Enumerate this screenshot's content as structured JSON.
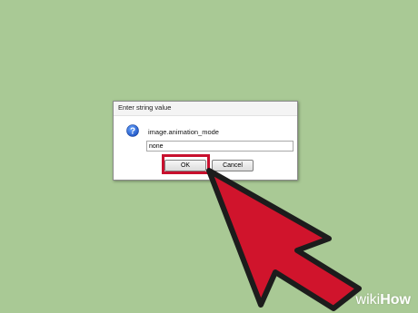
{
  "dialog": {
    "title": "Enter string value",
    "icon": "question-icon",
    "prompt_label": "image.animation_mode",
    "input_value": "none",
    "ok_label": "OK",
    "cancel_label": "Cancel"
  },
  "overlay": {
    "highlight_color": "#c8102e",
    "arrow_color": "#d0142c"
  },
  "watermark": {
    "prefix": "wiki",
    "suffix": "How"
  },
  "colors": {
    "background": "#a9c995"
  }
}
